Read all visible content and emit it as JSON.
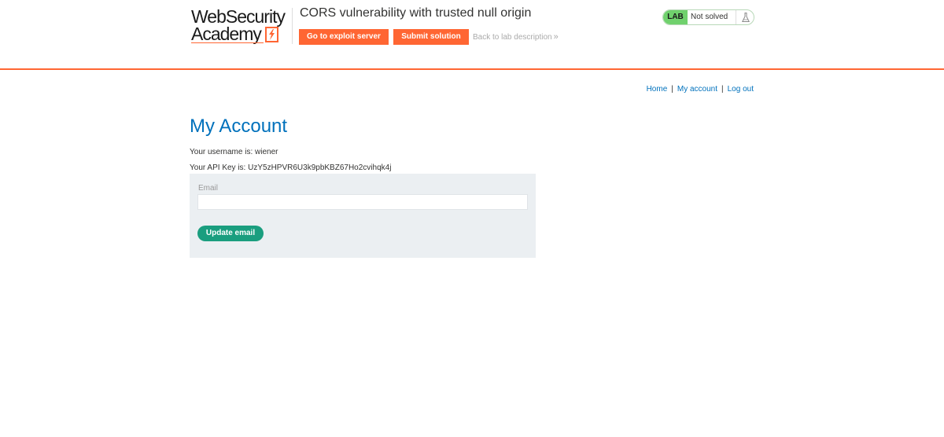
{
  "header": {
    "logo_line1": "WebSecurity",
    "logo_line2": "Academy",
    "lab_title": "CORS vulnerability with trusted null origin",
    "exploit_button": "Go to exploit server",
    "submit_button": "Submit solution",
    "back_link": "Back to lab description",
    "back_chevron": "»",
    "lab_badge": "LAB",
    "lab_status": "Not solved"
  },
  "nav": {
    "home": "Home",
    "sep1": "|",
    "my_account": "My account",
    "sep2": "|",
    "logout": "Log out"
  },
  "main": {
    "title": "My Account",
    "username_line": "Your username is: wiener",
    "api_key_line": "Your API Key is: UzY5zHPVR6U3k9pbKBZ67Ho2cvihqk4j"
  },
  "form": {
    "email_label": "Email",
    "email_value": "",
    "update_button": "Update email"
  },
  "colors": {
    "accent_orange": "#ff6633",
    "link_blue": "#0071bc",
    "lab_green": "#70d16d",
    "update_teal": "#1a9e7f",
    "form_bg": "#ebeff2"
  },
  "icons": {
    "logo_mark": "lightning-bolt-icon",
    "flask": "flask-icon"
  }
}
